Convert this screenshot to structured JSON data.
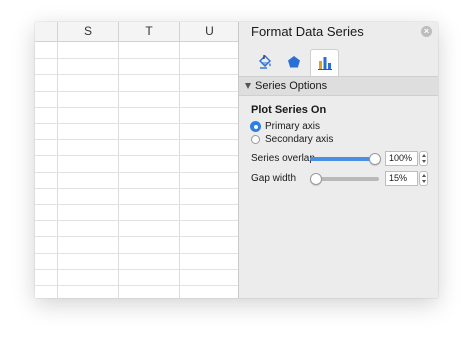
{
  "spreadsheet": {
    "columns": [
      "S",
      "T",
      "U"
    ]
  },
  "pane": {
    "title": "Format Data Series",
    "close_icon": "close-icon",
    "tabs": [
      {
        "icon": "paint-bucket-icon",
        "active": false
      },
      {
        "icon": "pentagon-icon",
        "active": false
      },
      {
        "icon": "bar-chart-icon",
        "active": true
      }
    ],
    "section": {
      "label": "Series Options",
      "expanded": true
    },
    "plot_series_on": {
      "label": "Plot Series On",
      "options": [
        {
          "label": "Primary axis",
          "selected": true
        },
        {
          "label": "Secondary axis",
          "selected": false
        }
      ]
    },
    "series_overlap": {
      "label": "Series overlap",
      "value": "100%",
      "level": 1.0
    },
    "gap_width": {
      "label": "Gap width",
      "value": "15%",
      "level": 0.0
    }
  },
  "colors": {
    "accent": "#2f7fe0",
    "pane_background": "#ececec",
    "icon_blue": "#2a6fd6",
    "icon_gold": "#d9a521"
  }
}
